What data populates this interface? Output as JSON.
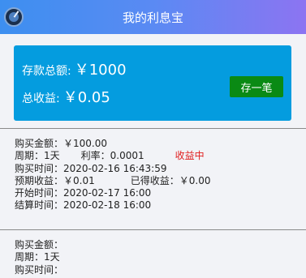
{
  "header": {
    "title": "我的利息宝"
  },
  "summary": {
    "deposit_label": "存款总额:",
    "deposit_amount": "￥1000",
    "income_label": "总收益:",
    "income_amount": "￥0.05",
    "deposit_button": "存一笔"
  },
  "records": [
    {
      "amount_label": "购买金额：",
      "amount": "￥100.00",
      "period_label": "周期：",
      "period": "1天",
      "rate_label": "利率：",
      "rate": "0.0001",
      "status": "收益中",
      "buy_time_label": "购买时间：",
      "buy_time": "2020-02-16 16:43:59",
      "expected_label": "预期收益：",
      "expected": "￥0.01",
      "earned_label": "已得收益：",
      "earned": "￥0.00",
      "start_label": "开始时间：",
      "start": "2020-02-17 16:00",
      "settle_label": "结算时间：",
      "settle": "2020-02-18 16:00"
    },
    {
      "amount_label": "购买金额：",
      "amount": "",
      "period_label": "周期：",
      "period": "1天",
      "buy_time_label": "购买时间：",
      "buy_time": ""
    }
  ]
}
